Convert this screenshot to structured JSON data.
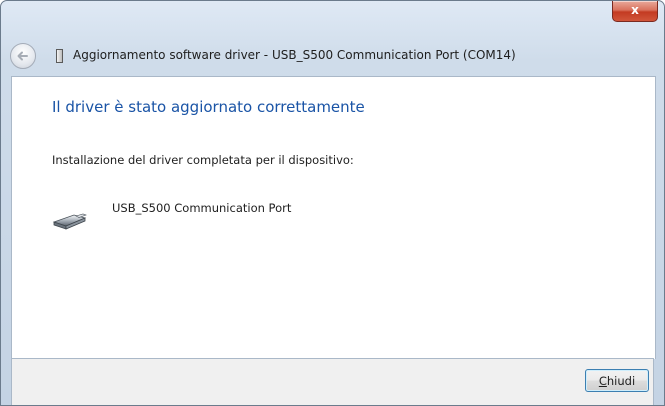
{
  "window": {
    "title": "Aggiornamento software driver - USB_S500 Communication Port (COM14)",
    "close_glyph": "x"
  },
  "content": {
    "heading": "Il driver è stato aggiornato correttamente",
    "description": "Installazione del driver completata per il dispositivo:",
    "device_name": "USB_S500 Communication Port",
    "device_icon": "usb-port-icon"
  },
  "footer": {
    "close_label_accel": "C",
    "close_label_rest": "hiudi"
  },
  "colors": {
    "heading": "#1a54a6",
    "close_red": "#c33b22"
  }
}
